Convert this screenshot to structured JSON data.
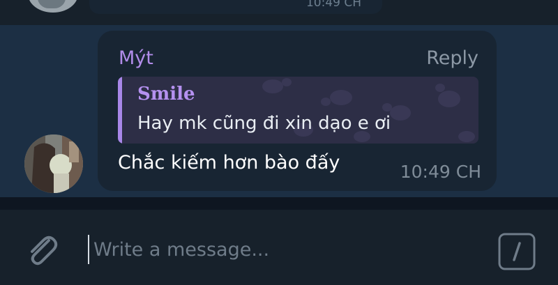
{
  "previous_message": {
    "time": "10:49 CH"
  },
  "message": {
    "sender": "Mýt",
    "reply_action": "Reply",
    "quote": {
      "author": "Smile",
      "text": "Hay mk cũng đi xin dạo e ơi"
    },
    "text": "Chắc kiếm hơn bào đấy",
    "time": "10:49 CH"
  },
  "composer": {
    "placeholder": "Write a message...",
    "attach_icon": "paperclip-icon",
    "commands_icon": "slash-commands-icon"
  },
  "colors": {
    "chat_background": "#1c2f44",
    "bubble": "#182533",
    "sender_accent": "#b18ce9",
    "quote_background": "#2d2e46",
    "composer_background": "#17212b"
  }
}
